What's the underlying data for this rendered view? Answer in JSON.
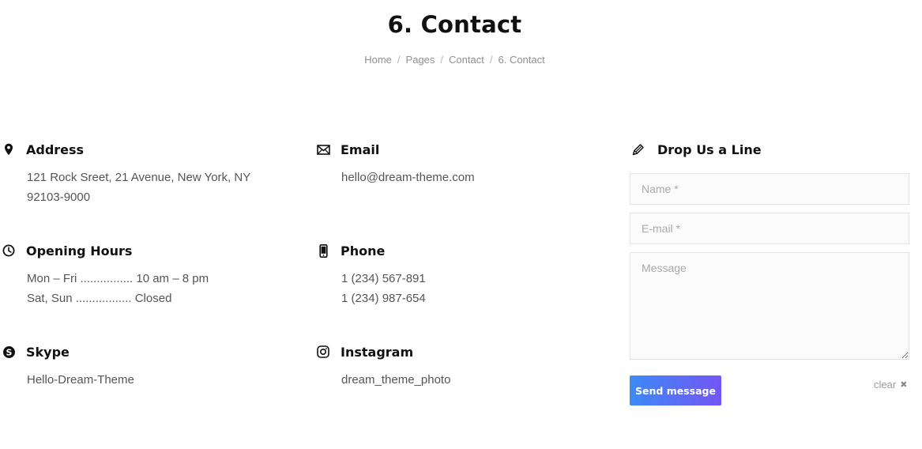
{
  "header": {
    "title": "6. Contact",
    "breadcrumb": [
      "Home",
      "Pages",
      "Contact",
      "6. Contact"
    ],
    "separator": "/"
  },
  "contact": {
    "address": {
      "icon": "map-pin-icon",
      "title": "Address",
      "lines": [
        "121 Rock Sreet, 21 Avenue, New York, NY",
        "92103-9000"
      ]
    },
    "email": {
      "icon": "envelope-icon",
      "title": "Email",
      "lines": [
        "hello@dream-theme.com"
      ]
    },
    "hours": {
      "icon": "clock-icon",
      "title": "Opening Hours",
      "lines": [
        "Mon – Fri ................ 10 am – 8 pm",
        "Sat, Sun ................. Closed"
      ]
    },
    "phone": {
      "icon": "mobile-phone-icon",
      "title": "Phone",
      "lines": [
        "1 (234) 567-891",
        "1 (234) 987-654"
      ]
    },
    "skype": {
      "icon": "skype-icon",
      "title": "Skype",
      "lines": [
        "Hello-Dream-Theme"
      ]
    },
    "instagram": {
      "icon": "instagram-icon",
      "title": "Instagram",
      "lines": [
        "dream_theme_photo"
      ]
    }
  },
  "form": {
    "icon": "pen-icon",
    "title": "Drop Us a Line",
    "name_placeholder": "Name *",
    "email_placeholder": "E-mail *",
    "message_placeholder": "Message",
    "name_value": "",
    "email_value": "",
    "message_value": "",
    "submit_label": "Send message",
    "clear_label": "clear",
    "clear_icon": "close-icon",
    "button_gradient": [
      "#3d8af6",
      "#7356f5"
    ]
  }
}
